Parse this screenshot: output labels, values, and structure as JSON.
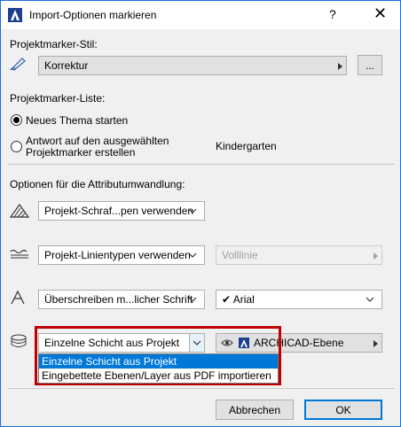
{
  "window": {
    "title": "Import-Optionen markieren",
    "help": "?",
    "close": "✕"
  },
  "marker_style": {
    "label": "Projektmarker-Stil:",
    "value": "Korrektur",
    "more_button": "..."
  },
  "marker_list": {
    "label": "Projektmarker-Liste:",
    "option_new": "Neues Thema starten",
    "option_reply": "Antwort auf den ausgewählten Projektmarker erstellen",
    "reply_target": "Kindergarten",
    "selected": "new"
  },
  "conversion": {
    "label": "Optionen für die Attributumwandlung:",
    "fill": {
      "value": "Projekt-Schraf...pen verwenden"
    },
    "linetype": {
      "value": "Projekt-Linientypen verwenden",
      "secondary": "Volllinie"
    },
    "font": {
      "value": "Überschreiben m...licher Schrift",
      "secondary": "Arial",
      "check": "✔"
    },
    "layer": {
      "value": "Einzelne Schicht aus Projekt",
      "secondary": "ARCHICAD-Ebene",
      "options": [
        "Einzelne Schicht aus Projekt",
        "Eingebettete Ebenen/Layer aus PDF importieren"
      ]
    }
  },
  "buttons": {
    "cancel": "Abbrechen",
    "ok": "OK"
  },
  "colors": {
    "accent": "#0078d7",
    "highlight_border": "#c00000"
  }
}
